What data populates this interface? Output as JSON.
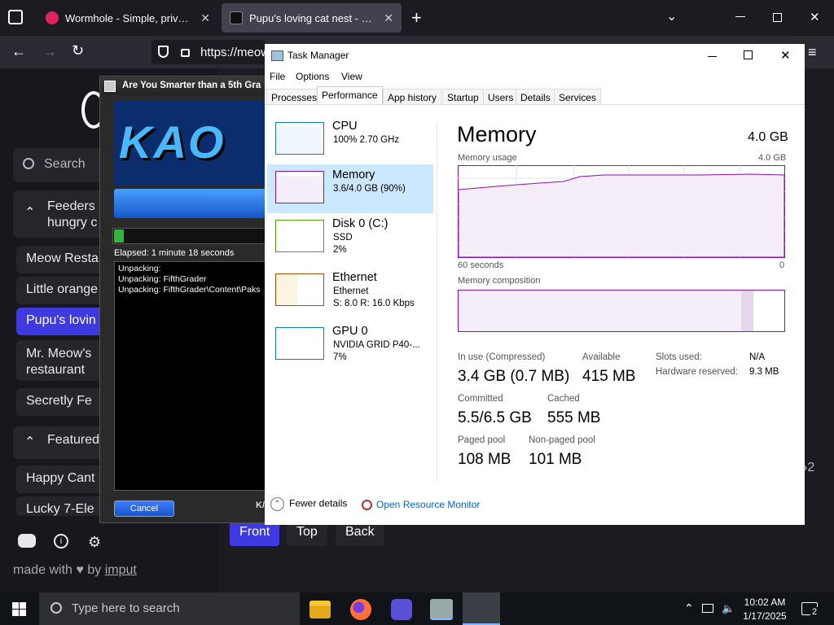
{
  "browser": {
    "tabs": [
      {
        "title": "Wormhole - Simple, private file",
        "favicon": "wormhole-icon",
        "color": "#e0245e"
      },
      {
        "title": "Pupu's loving cat nest - meow.c",
        "favicon": "cat-icon",
        "color": "#3a3a3a"
      }
    ],
    "url": "https://meow"
  },
  "site": {
    "search_placeholder": "Search",
    "groups": [
      {
        "label": "Feeders hungry c",
        "items": [
          "Meow Resta",
          "Little orange",
          "Pupu's lovin",
          "Mr. Meow's restaurant",
          "Secretly Fe"
        ]
      },
      {
        "label": "Featured",
        "items": [
          "Happy Cant",
          "Lucky 7-Ele"
        ]
      }
    ],
    "active_item": "Pupu's lovin",
    "buttons": [
      "Front",
      "Top",
      "Back"
    ],
    "footer": {
      "prefix": "made with",
      "by": "by",
      "author": "imput"
    },
    "page_count_fragment": "2"
  },
  "installer": {
    "title": "Are You Smarter than a 5th Gra",
    "logo_text": "KAO",
    "elapsed": "Elapsed:  1 minute 18 seconds",
    "log": [
      "Unpacking:",
      "Unpacking: FifthGrader",
      "Unpacking: FifthGrader\\Content\\Paks"
    ],
    "cancel": "Cancel",
    "brand_fragment": "K/",
    "progress": 0.06
  },
  "taskmanager": {
    "title": "Task Manager",
    "menus": [
      "File",
      "Options",
      "View"
    ],
    "tabs": [
      "Processes",
      "Performance",
      "App history",
      "Startup",
      "Users",
      "Details",
      "Services"
    ],
    "active_tab": "Performance",
    "devices": [
      {
        "name": "CPU",
        "line1": "100%  2.70 GHz",
        "line2": "",
        "color": "#117dbb"
      },
      {
        "name": "Memory",
        "line1": "3.6/4.0 GB (90%)",
        "line2": "",
        "color": "#8b12ae"
      },
      {
        "name": "Disk 0 (C:)",
        "line1": "SSD",
        "line2": "2%",
        "color": "#4da60c"
      },
      {
        "name": "Ethernet",
        "line1": "Ethernet",
        "line2": "S: 8.0  R: 16.0 Kbps",
        "color": "#a74f01"
      },
      {
        "name": "GPU 0",
        "line1": "NVIDIA GRID P40-...",
        "line2": "7%",
        "color": "#117dbb"
      }
    ],
    "detail": {
      "title": "Memory",
      "total": "4.0 GB",
      "usage_label": "Memory usage",
      "usage_max": "4.0 GB",
      "time_left": "60 seconds",
      "time_right": "0",
      "composition_label": "Memory composition",
      "stats": {
        "in_use_label": "In use (Compressed)",
        "in_use": "3.4 GB (0.7 MB)",
        "available_label": "Available",
        "available": "415 MB",
        "slots_label": "Slots used:",
        "slots": "N/A",
        "hw_label": "Hardware reserved:",
        "hw": "9.3 MB",
        "committed_label": "Committed",
        "committed": "5.5/6.5 GB",
        "cached_label": "Cached",
        "cached": "555 MB",
        "paged_label": "Paged pool",
        "paged": "108 MB",
        "nonpaged_label": "Non-paged pool",
        "nonpaged": "101 MB"
      }
    },
    "footer": {
      "fewer": "Fewer details",
      "monitor": "Open Resource Monitor"
    }
  },
  "taskbar": {
    "search_placeholder": "Type here to search",
    "time": "10:02 AM",
    "date": "1/17/2025",
    "notifications": "2"
  }
}
